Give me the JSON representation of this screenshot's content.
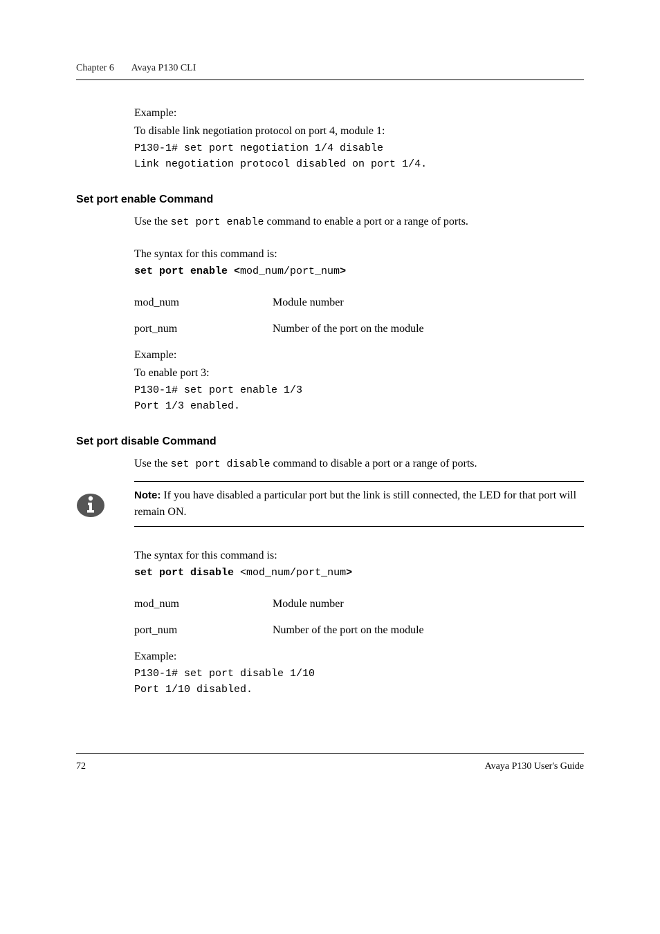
{
  "running_head": {
    "chapter_label": "Chapter 6",
    "chapter_title": "Avaya P130 CLI"
  },
  "intro_block": {
    "example_label": "Example:",
    "example_desc": "To disable link negotiation protocol on port 4, module 1:",
    "code_line1": "P130-1# set port negotiation 1/4 disable",
    "code_line2": "Link negotiation protocol disabled on port 1/4."
  },
  "section_enable": {
    "heading": "Set port enable Command",
    "desc_pre": "Use the ",
    "desc_code": "set port enable",
    "desc_post": " command to enable a port or a range of ports.",
    "syntax_label": "The syntax for this command is:",
    "syntax_kw": "set port enable <",
    "syntax_arg": "mod_num/port_num",
    "syntax_close": ">",
    "params": [
      {
        "name": "mod_num",
        "desc": "Module number"
      },
      {
        "name": "port_num",
        "desc": "Number of the port on the module"
      }
    ],
    "example_label": "Example:",
    "example_desc": "To enable port 3:",
    "code_line1": "P130-1# set port enable 1/3",
    "code_line2": "Port 1/3 enabled."
  },
  "section_disable": {
    "heading": "Set port disable Command",
    "desc_pre": "Use the ",
    "desc_code": "set port disable",
    "desc_post": " command to disable a port or a range of ports.",
    "note_label": "Note:",
    "note_text": "  If you have disabled a particular port but the link is still connected, the LED for that port will remain ON.",
    "syntax_label": "The syntax for this command is:",
    "syntax_kw": "set port disable ",
    "syntax_open": "<",
    "syntax_arg": "mod_num/port_num",
    "syntax_close": ">",
    "params": [
      {
        "name": "mod_num",
        "desc": "Module number"
      },
      {
        "name": "port_num",
        "desc": "Number of the port on the module"
      }
    ],
    "example_label": "Example:",
    "code_line1": "P130-1# set port disable 1/10",
    "code_line2": "Port 1/10 disabled."
  },
  "footer": {
    "page_number": "72",
    "guide_title": "Avaya P130 User's Guide"
  }
}
